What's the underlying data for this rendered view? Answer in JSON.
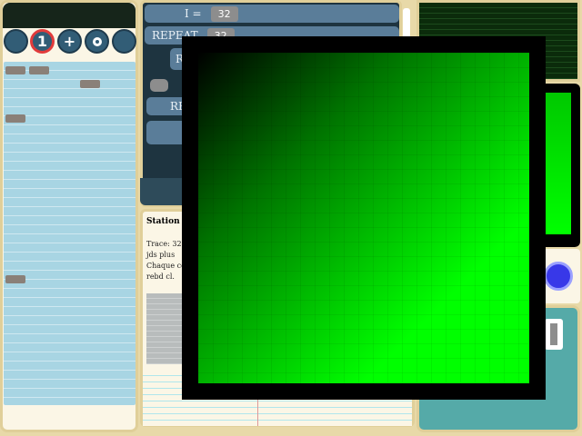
{
  "toolbar": {
    "buttons": [
      {
        "icon": "circle-icon",
        "glyph": ""
      },
      {
        "icon": "number-one-icon",
        "glyph": "1"
      },
      {
        "icon": "plus-icon",
        "glyph": "+"
      },
      {
        "icon": "ring-icon",
        "glyph": ""
      },
      {
        "icon": "circle-icon",
        "glyph": ""
      }
    ]
  },
  "code": {
    "tag_rows": [
      0,
      4,
      23
    ]
  },
  "blocks": {
    "assign_var": "I =",
    "assign_value": "32",
    "repeat_label": "REPEAT",
    "repeat_value": "32",
    "block3_label": "R",
    "block4_label": "RE"
  },
  "info": {
    "title": "Station d",
    "text_lines": [
      "Trace: 32",
      "jds plus",
      "Chaque co",
      "rebd cl."
    ]
  },
  "colors": {
    "stage_fill": "#00ff00",
    "go_button": "#3838e8",
    "tool_button": "#325d76",
    "active_ring": "#e23b3b"
  }
}
